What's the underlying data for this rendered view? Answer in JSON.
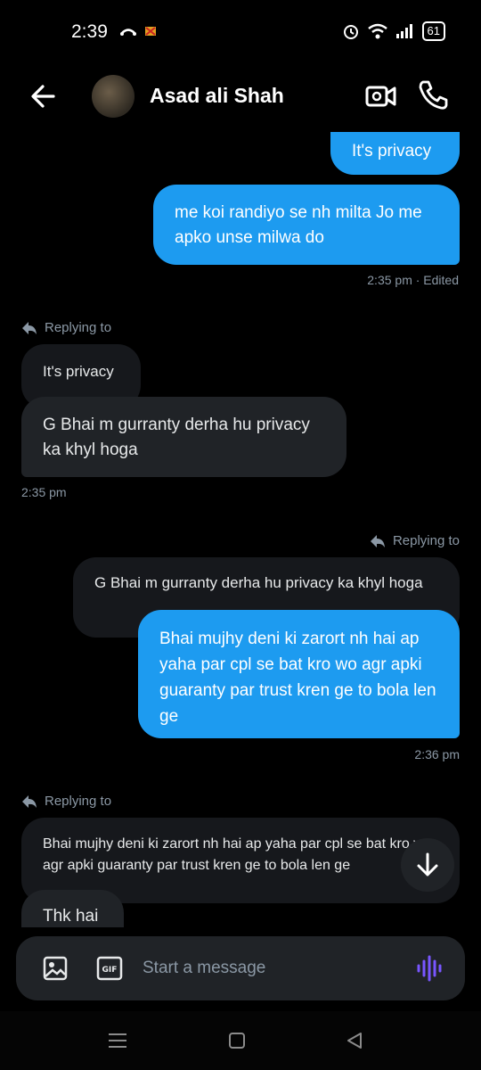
{
  "status_bar": {
    "time": "2:39",
    "battery": "61"
  },
  "header": {
    "contact_name": "Asad ali Shah"
  },
  "messages": {
    "out1": "It's privacy",
    "out2": "me koi randiyo se nh milta Jo me apko unse milwa do",
    "out2_meta": "2:35 pm · Edited",
    "reply1_label": "Replying to",
    "reply1_quote": "It's privacy",
    "in1": "G Bhai m gurranty derha hu privacy ka khyl hoga",
    "in1_meta": "2:35 pm",
    "reply2_label": "Replying to",
    "reply2_quote": "G Bhai m gurranty derha hu privacy ka khyl hoga",
    "out3": "Bhai mujhy deni ki zarort nh hai ap yaha par cpl se bat kro wo agr apki guaranty par trust kren ge to bola len ge",
    "out3_meta": "2:36 pm",
    "reply3_label": "Replying to",
    "reply3_quote": "Bhai mujhy deni ki zarort nh hai ap yaha par cpl se bat kro wo agr apki guaranty par trust kren ge to bola len ge",
    "in2": "Thk hai"
  },
  "composer": {
    "placeholder": "Start a message"
  },
  "icons": {
    "back": "arrow-left-icon",
    "video": "video-call-icon",
    "call": "phone-icon",
    "image": "image-icon",
    "gif": "gif-icon",
    "voice": "voice-wave-icon",
    "scroll": "arrow-down-icon",
    "reply": "reply-arrow-icon"
  },
  "colors": {
    "accent": "#1d9bf0",
    "incoming": "#202327",
    "voice": "#7856ff"
  }
}
